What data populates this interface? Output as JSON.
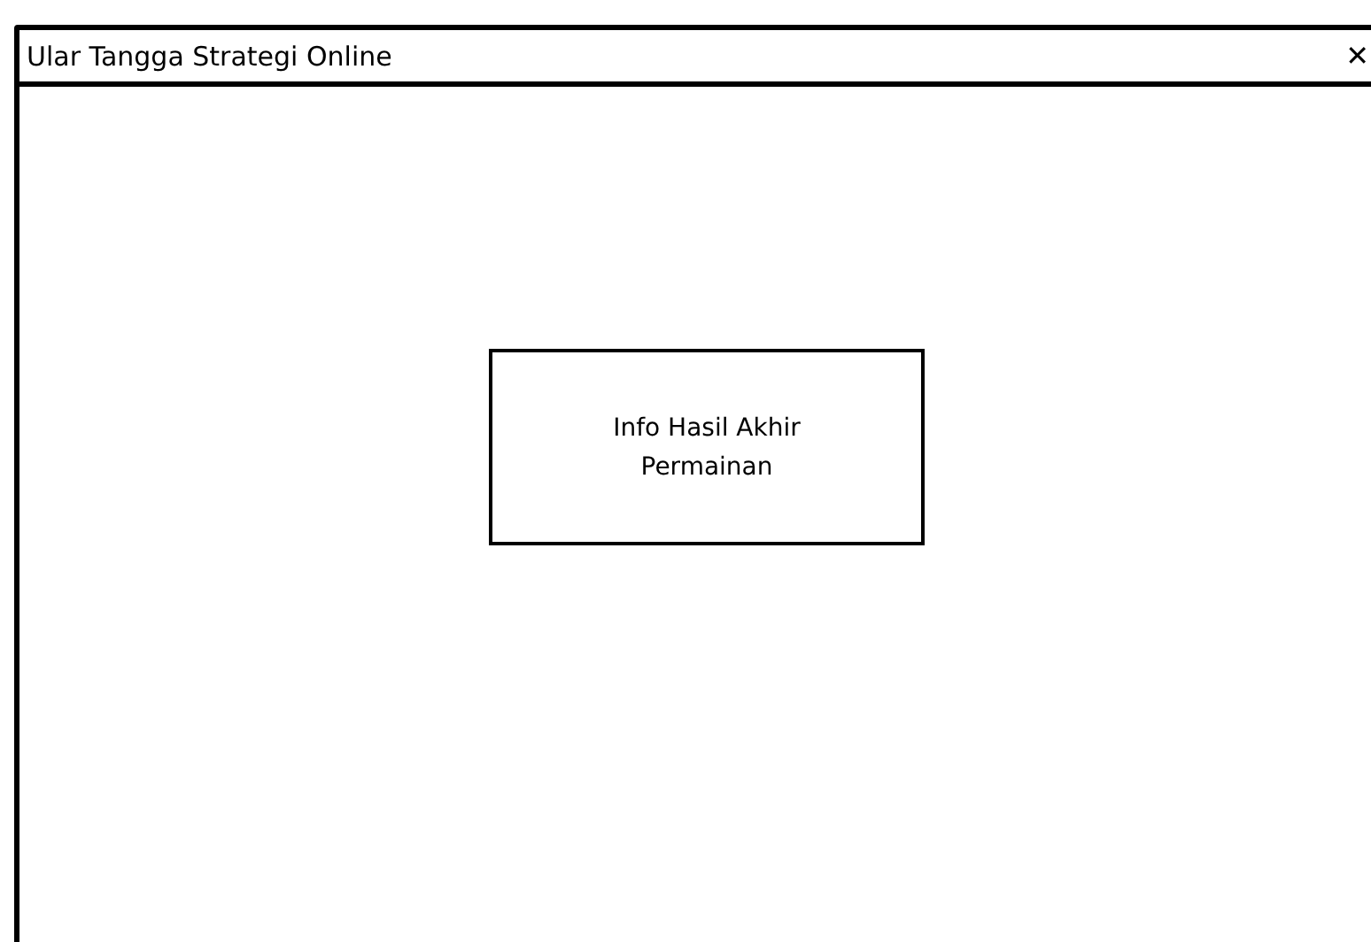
{
  "window": {
    "title": "Ular Tangga Strategi Online",
    "close": "✕"
  },
  "panel": {
    "text": "Info Hasil Akhir Permainan"
  }
}
